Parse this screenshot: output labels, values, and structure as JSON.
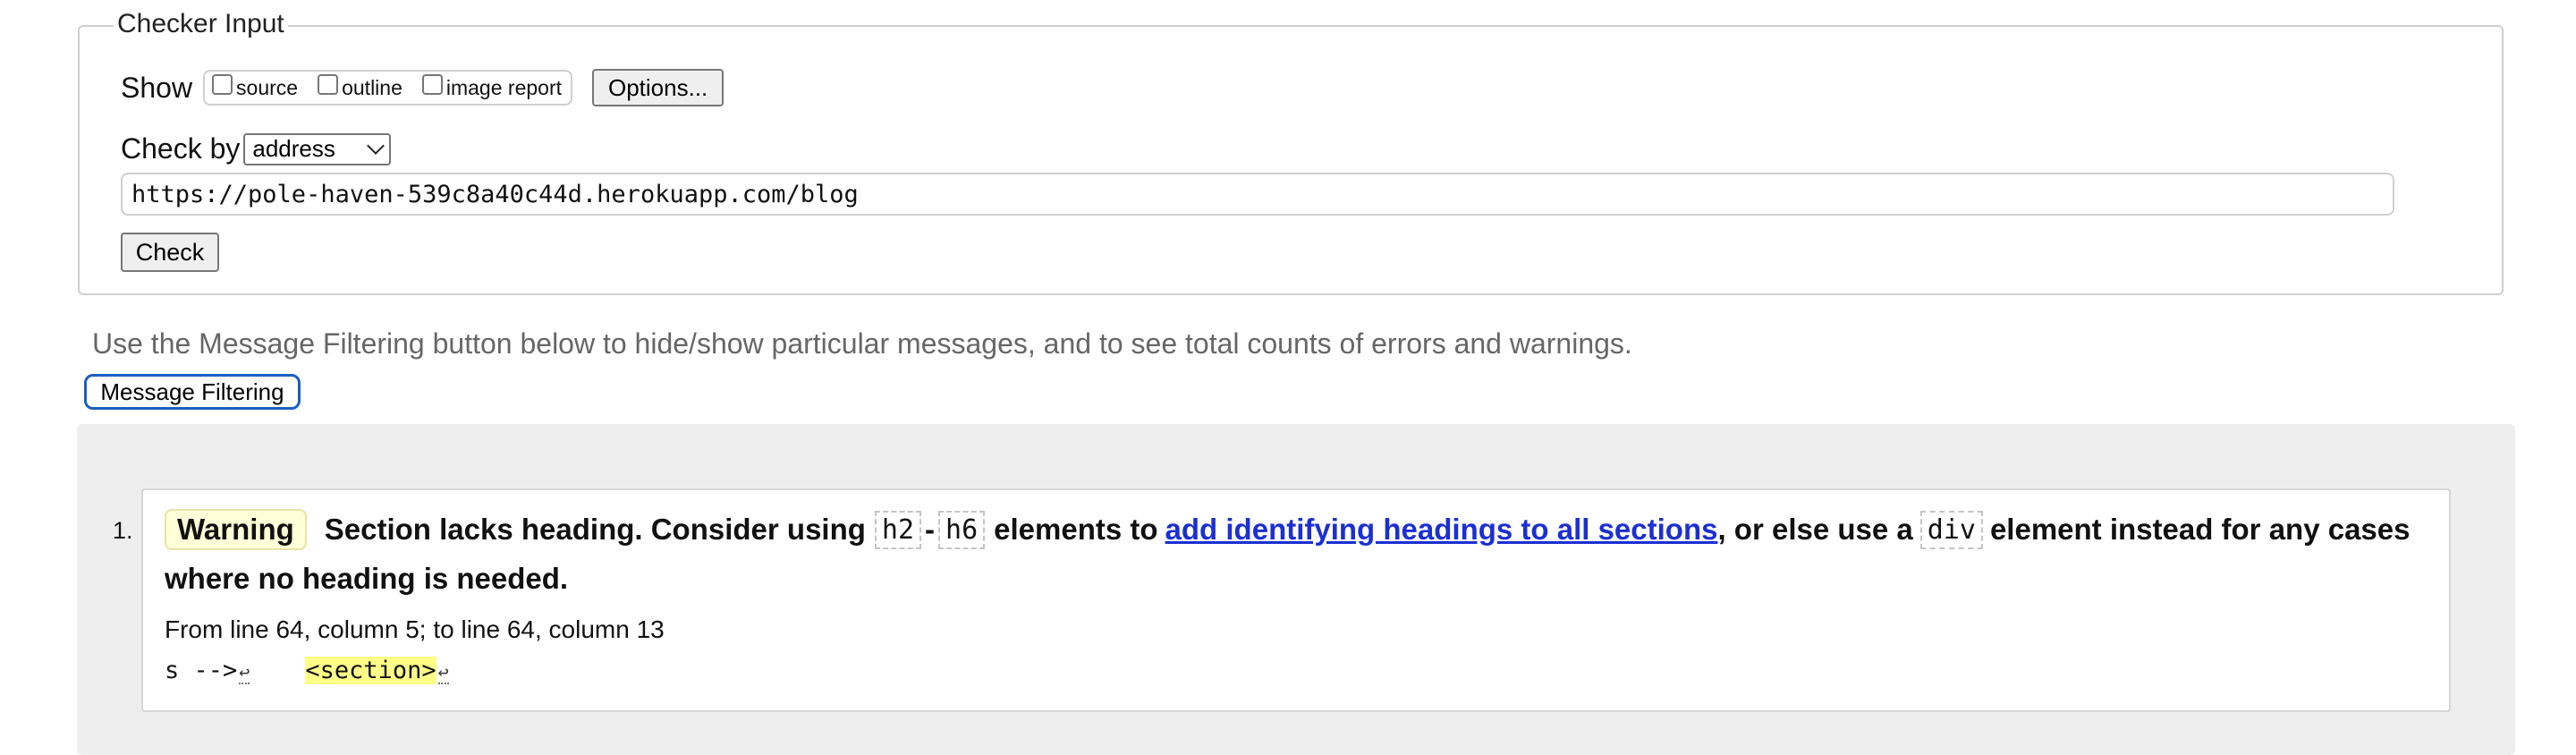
{
  "checker": {
    "legend": "Checker Input",
    "show_label": "Show",
    "show_options": [
      {
        "label": "source",
        "checked": false
      },
      {
        "label": "outline",
        "checked": false
      },
      {
        "label": "image report",
        "checked": false
      }
    ],
    "options_button": "Options...",
    "check_by_label": "Check by",
    "check_by_value": "address",
    "url_value": "https://pole-haven-539c8a40c44d.herokuapp.com/blog",
    "check_button": "Check"
  },
  "filter": {
    "hint": "Use the Message Filtering button below to hide/show particular messages, and to see total counts of errors and warnings.",
    "button": "Message Filtering"
  },
  "messages": [
    {
      "number": "1.",
      "type": "Warning",
      "text_1": "Section lacks heading. Consider using",
      "code_1": "h2",
      "dash": "-",
      "code_2": "h6",
      "text_2": "elements to",
      "link": "add identifying headings to all sections",
      "text_3": ", or else use a",
      "code_3": "div",
      "text_4": "element instead for any cases",
      "text_5": "where no heading is needed.",
      "location": "From line 64, column 5; to line 64, column 13",
      "extract_pre": "s -->",
      "extract_highlight": "<section>",
      "return_symbol": "↩"
    }
  ],
  "colors": {
    "warning_badge_bg": "#ffffd8",
    "link": "#1b2fd3",
    "filter_button_border": "#1a5fc4",
    "results_bg": "#eeeeee",
    "highlight": "#ffff88"
  }
}
